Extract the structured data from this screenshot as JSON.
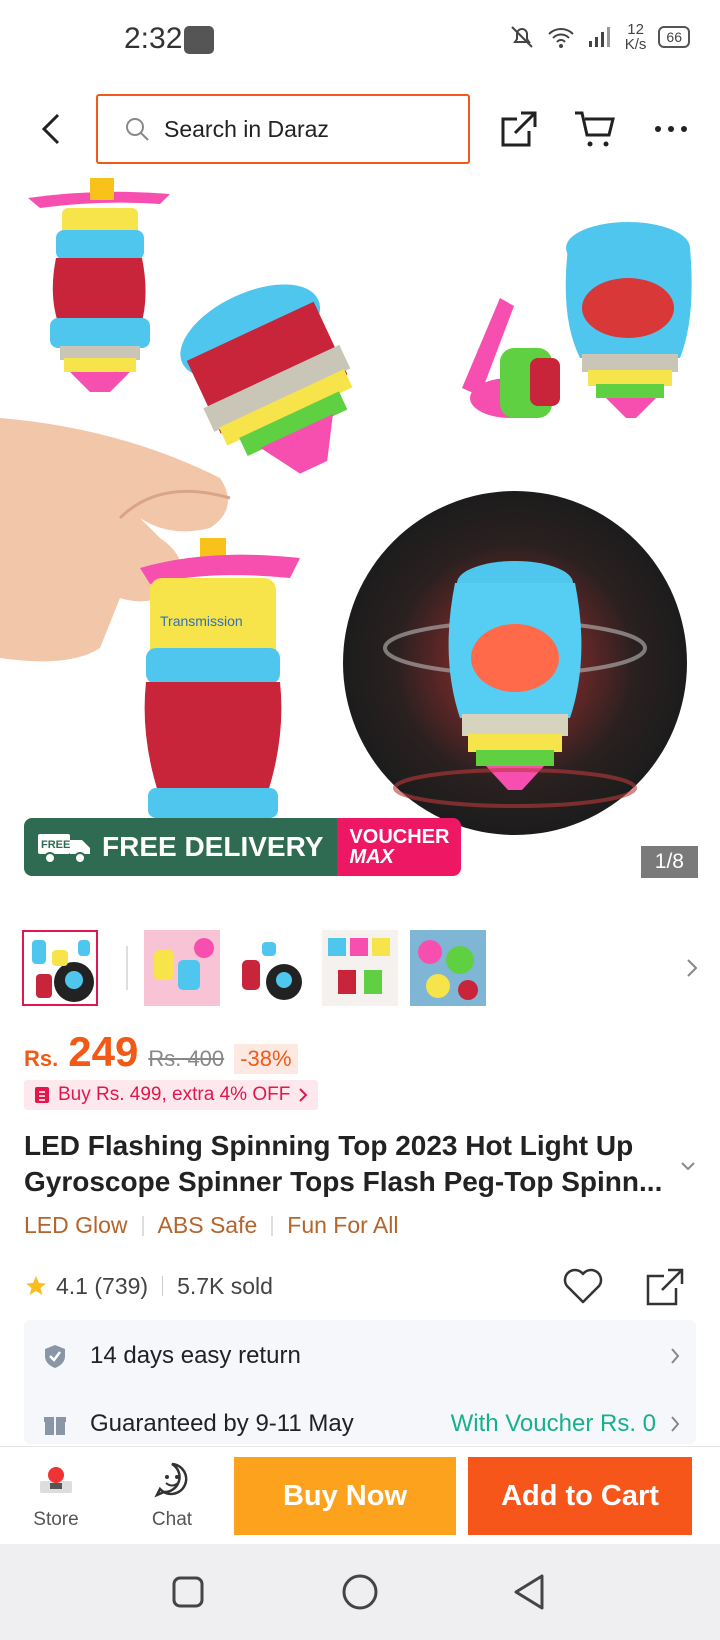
{
  "status": {
    "time": "2:32",
    "speed_value": "12",
    "speed_unit": "K/s",
    "battery": "66"
  },
  "header": {
    "search_placeholder": "Search in Daraz"
  },
  "hero": {
    "promo_free": "FREE DELIVERY",
    "promo_free_badge": "FREE",
    "promo_voucher_top": "VOUCHER",
    "promo_voucher_bottom": "MAX",
    "pager": "1/8",
    "product_label": "Transmission"
  },
  "thumbnails": {
    "count": 5
  },
  "price": {
    "currency": "Rs.",
    "current": "249",
    "original": "Rs. 400",
    "discount": "-38%",
    "offer": "Buy Rs. 499, extra 4% OFF"
  },
  "product": {
    "title_line1": "LED Flashing Spinning Top 2023 Hot Light Up",
    "title_line2": "Gyroscope Spinner Tops Flash Peg-Top Spinn...",
    "tags": [
      "LED Glow",
      "ABS Safe",
      "Fun For All"
    ],
    "rating": "4.1 (739)",
    "sold": "5.7K sold"
  },
  "services": {
    "return": "14 days easy return",
    "delivery": "Guaranteed by 9-11 May",
    "voucher": "With Voucher Rs. 0"
  },
  "bottom_bar": {
    "store": "Store",
    "chat": "Chat",
    "buy_now": "Buy Now",
    "add_to_cart": "Add to Cart"
  },
  "colors": {
    "accent": "#f05a16",
    "buy_now": "#fca21d",
    "add_to_cart": "#f7561a",
    "tag": "#b5642c",
    "voucher_link": "#17b08f"
  }
}
